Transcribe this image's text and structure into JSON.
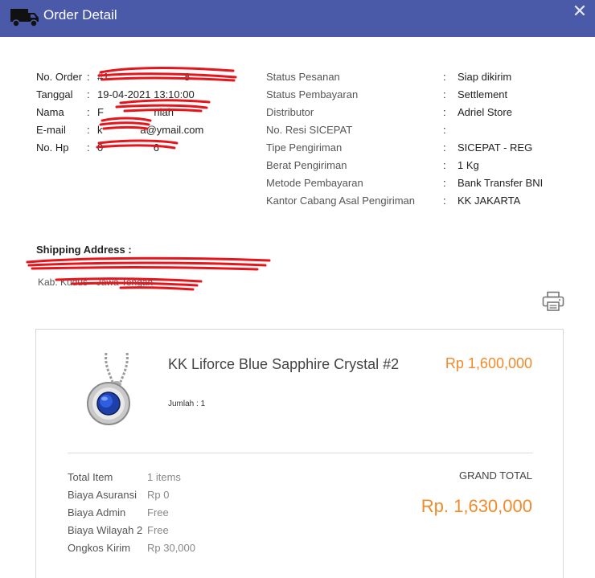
{
  "header": {
    "title": "Order Detail",
    "close_symbol": "✕",
    "background": "#4a5aa8"
  },
  "order": {
    "left": [
      {
        "label": "No. Order",
        "colon": ":",
        "value": "#1                                    8"
      },
      {
        "label": "Tanggal",
        "colon": ":",
        "value": "19-04-2021 13:10:00"
      },
      {
        "label": "Nama",
        "colon": ":",
        "value": "F                        niah"
      },
      {
        "label": "E-mail",
        "colon": ":",
        "value": "k                  a@ymail.com"
      },
      {
        "label": "No. Hp",
        "colon": ":",
        "value": "0                        6"
      }
    ],
    "right": [
      {
        "label": "Status Pesanan",
        "colon": ":",
        "value": "Siap dikirim"
      },
      {
        "label": "Status Pembayaran",
        "colon": ":",
        "value": "Settlement"
      },
      {
        "label": "Distributor",
        "colon": ":",
        "value": "Adriel Store"
      },
      {
        "label": "No. Resi SICEPAT",
        "colon": ":",
        "value": ""
      },
      {
        "label": "Tipe Pengiriman",
        "colon": ":",
        "value": "SICEPAT - REG"
      },
      {
        "label": "Berat Pengiriman",
        "colon": ":",
        "value": "1 Kg"
      },
      {
        "label": "Metode Pembayaran",
        "colon": ":",
        "value": "Bank Transfer BNI"
      },
      {
        "label": "Kantor Cabang Asal Pengiriman",
        "colon": ":",
        "value": "KK JAKARTA"
      }
    ]
  },
  "shipping": {
    "title": "Shipping Address :",
    "line1": "",
    "line2": "Kab. Kudus - Jawa Tengah"
  },
  "product": {
    "name": "KK Liforce Blue Sapphire Crystal #2",
    "qty": "Jumlah : 1",
    "price": "Rp 1,600,000",
    "price_color": "#f08a2b"
  },
  "summary": {
    "items": [
      {
        "label": "Total Item",
        "value": "1 items"
      },
      {
        "label": "Biaya Asuransi",
        "value": "Rp 0"
      },
      {
        "label": "Biaya Admin",
        "value": "Free"
      },
      {
        "label": "Biaya Wilayah 2",
        "value": "Free"
      },
      {
        "label": "Ongkos Kirim",
        "value": "Rp 30,000"
      }
    ],
    "grand_total_label": "GRAND TOTAL",
    "grand_total_value": "Rp. 1,630,000"
  },
  "icons": {
    "truck": "truck-icon",
    "close": "close-icon",
    "print": "printer-icon"
  }
}
